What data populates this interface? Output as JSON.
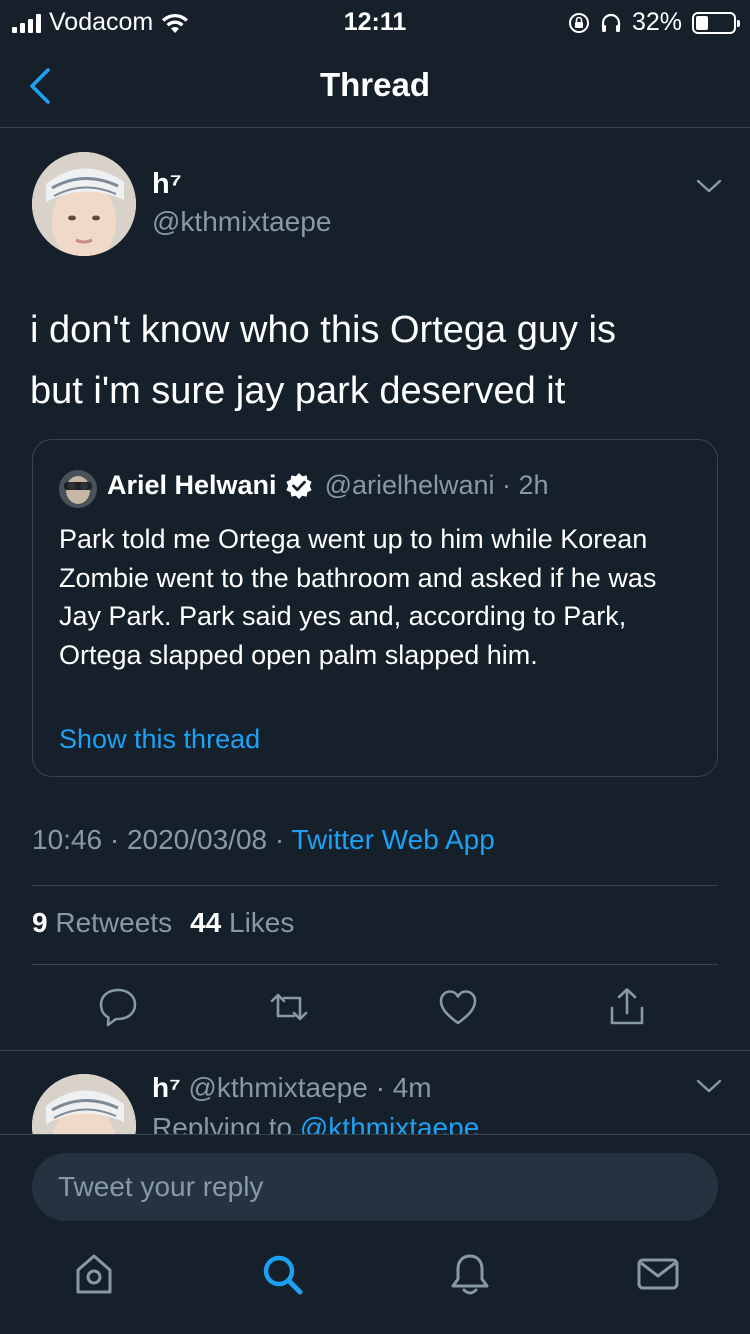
{
  "status_bar": {
    "carrier": "Vodacom",
    "time": "12:11",
    "battery": "32%",
    "battery_level": 0.32
  },
  "nav": {
    "title": "Thread",
    "back_icon": "chevron-left-icon"
  },
  "tweet": {
    "name": "h⁷",
    "handle": "@kthmixtaepe",
    "text_line1": "i don't know who this Ortega guy is",
    "text_line2": "but i'm sure jay park deserved it",
    "quote": {
      "name": "Ariel Helwani",
      "meta": "@arielhelwani · 2h",
      "text": "Park told me Ortega went up to him while Korean Zombie went to the bathroom and asked if he was Jay Park. Park said yes and, according to Park, Ortega slapped open palm slapped him.",
      "link": "Show this thread"
    },
    "time": "10:46 · 2020/03/08 · ",
    "source": "Twitter Web App",
    "retweets_count": "9",
    "retweets_label": "Retweets",
    "likes_count": "44",
    "likes_label": "Likes"
  },
  "reply": {
    "name": "h⁷",
    "meta": " @kthmixtaepe · 4m",
    "replying_prefix": "Replying to ",
    "replying_handle": "@kthmixtaepe"
  },
  "compose": {
    "placeholder": "Tweet your reply"
  },
  "colors": {
    "background": "#15202b",
    "accent": "#1da1f2",
    "muted": "#8899a6",
    "border": "#38444d"
  }
}
